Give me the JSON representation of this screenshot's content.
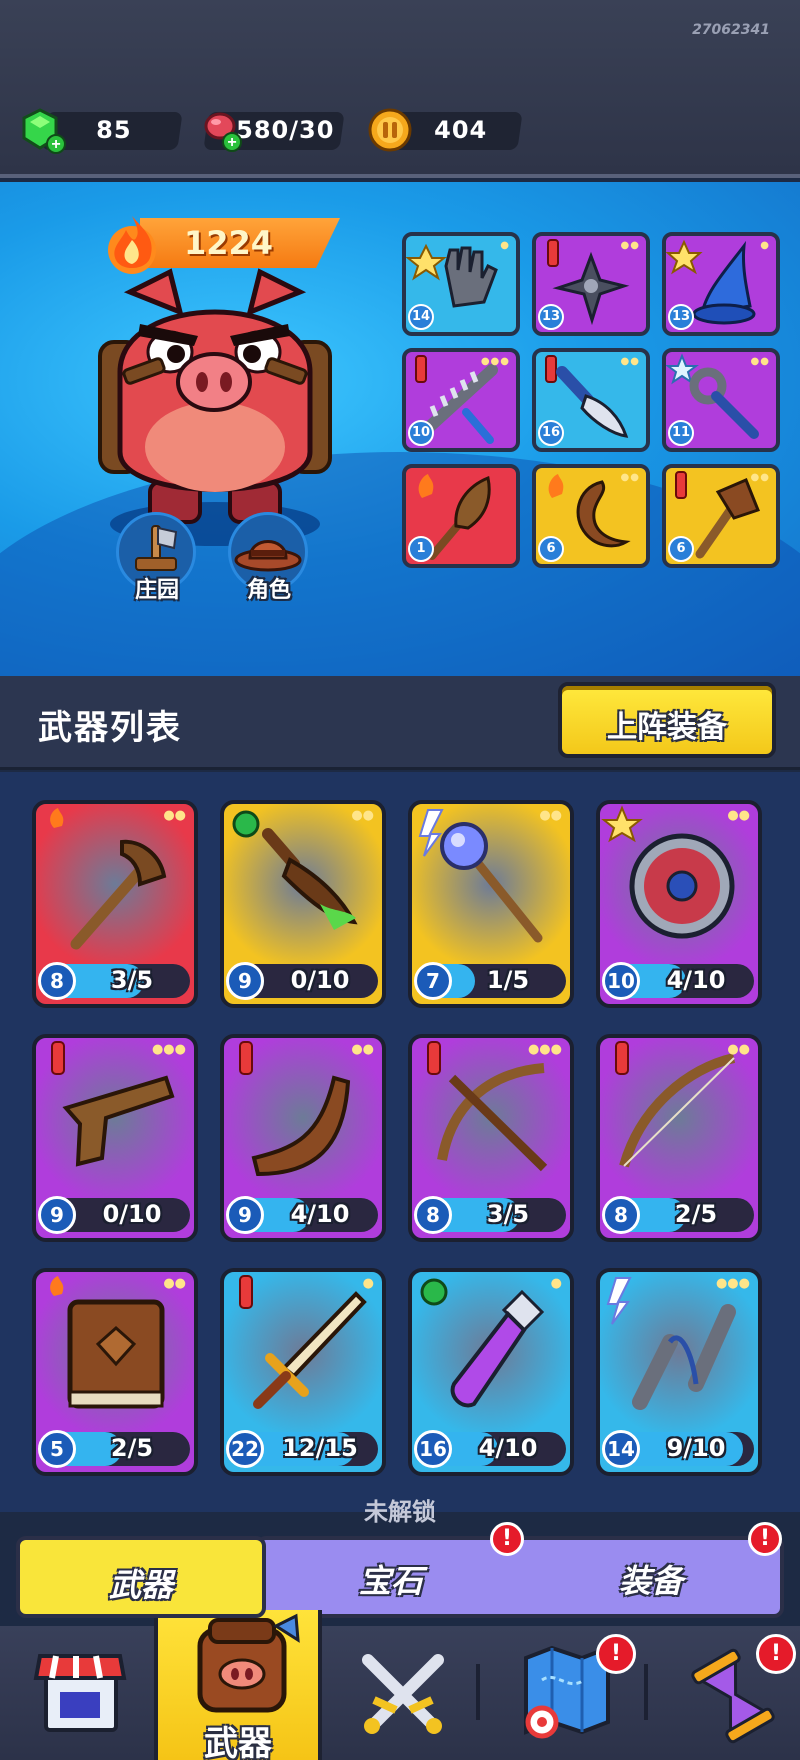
{
  "build_id": "27062341",
  "resources": {
    "gems": "85",
    "stamina": "580/30",
    "coins": "404"
  },
  "hero": {
    "power": "1224",
    "farm_label": "庄园",
    "character_label": "角色"
  },
  "equipped": [
    {
      "name": "glove-icon",
      "level": "14",
      "rarity": "blue",
      "color": "#35b8ea"
    },
    {
      "name": "shuriken-icon",
      "level": "13",
      "rarity": "purple",
      "color": "#b03ddc"
    },
    {
      "name": "wizard-hat-icon",
      "level": "13",
      "rarity": "purple",
      "color": "#b03ddc"
    },
    {
      "name": "spiked-club-icon",
      "level": "10",
      "rarity": "purple",
      "color": "#b03ddc"
    },
    {
      "name": "knife-icon",
      "level": "16",
      "rarity": "blue",
      "color": "#35b8ea"
    },
    {
      "name": "wrench-staff-icon",
      "level": "11",
      "rarity": "purple",
      "color": "#b03ddc"
    },
    {
      "name": "feather-fan-icon",
      "level": "1",
      "rarity": "red",
      "color": "#e8394a"
    },
    {
      "name": "horn-icon",
      "level": "6",
      "rarity": "yellow",
      "color": "#f3c321"
    },
    {
      "name": "axe-icon",
      "level": "6",
      "rarity": "yellow",
      "color": "#f3c321"
    }
  ],
  "section": {
    "title": "武器列表",
    "equip_button": "上阵装备"
  },
  "weapons": [
    {
      "name": "tomahawk",
      "level": "8",
      "count": "3/5",
      "progress": 0.6,
      "color": "#e8394a"
    },
    {
      "name": "poison-dagger",
      "level": "9",
      "count": "0/10",
      "progress": 0.0,
      "color": "#f3c321"
    },
    {
      "name": "orb-staff",
      "level": "7",
      "count": "1/5",
      "progress": 0.2,
      "color": "#f3c321"
    },
    {
      "name": "round-shield",
      "level": "10",
      "count": "4/10",
      "progress": 0.4,
      "color": "#b03ddc"
    },
    {
      "name": "pistol",
      "level": "9",
      "count": "0/10",
      "progress": 0.0,
      "color": "#b03ddc"
    },
    {
      "name": "boomerang",
      "level": "9",
      "count": "4/10",
      "progress": 0.4,
      "color": "#b03ddc"
    },
    {
      "name": "crossbow",
      "level": "8",
      "count": "3/5",
      "progress": 0.6,
      "color": "#b03ddc"
    },
    {
      "name": "longbow",
      "level": "8",
      "count": "2/5",
      "progress": 0.4,
      "color": "#b03ddc"
    },
    {
      "name": "spellbook",
      "level": "5",
      "count": "2/5",
      "progress": 0.4,
      "color": "#b03ddc"
    },
    {
      "name": "sword",
      "level": "22",
      "count": "12/15",
      "progress": 0.8,
      "color": "#35b8ea"
    },
    {
      "name": "potion-flask",
      "level": "16",
      "count": "4/10",
      "progress": 0.4,
      "color": "#35b8ea"
    },
    {
      "name": "nunchaku",
      "level": "14",
      "count": "9/10",
      "progress": 0.9,
      "color": "#35b8ea"
    }
  ],
  "locked_label": "未解锁",
  "tabs": {
    "weapons": "武器",
    "gems": "宝石",
    "gear": "装备"
  },
  "nav": {
    "weapons_label": "武器"
  }
}
